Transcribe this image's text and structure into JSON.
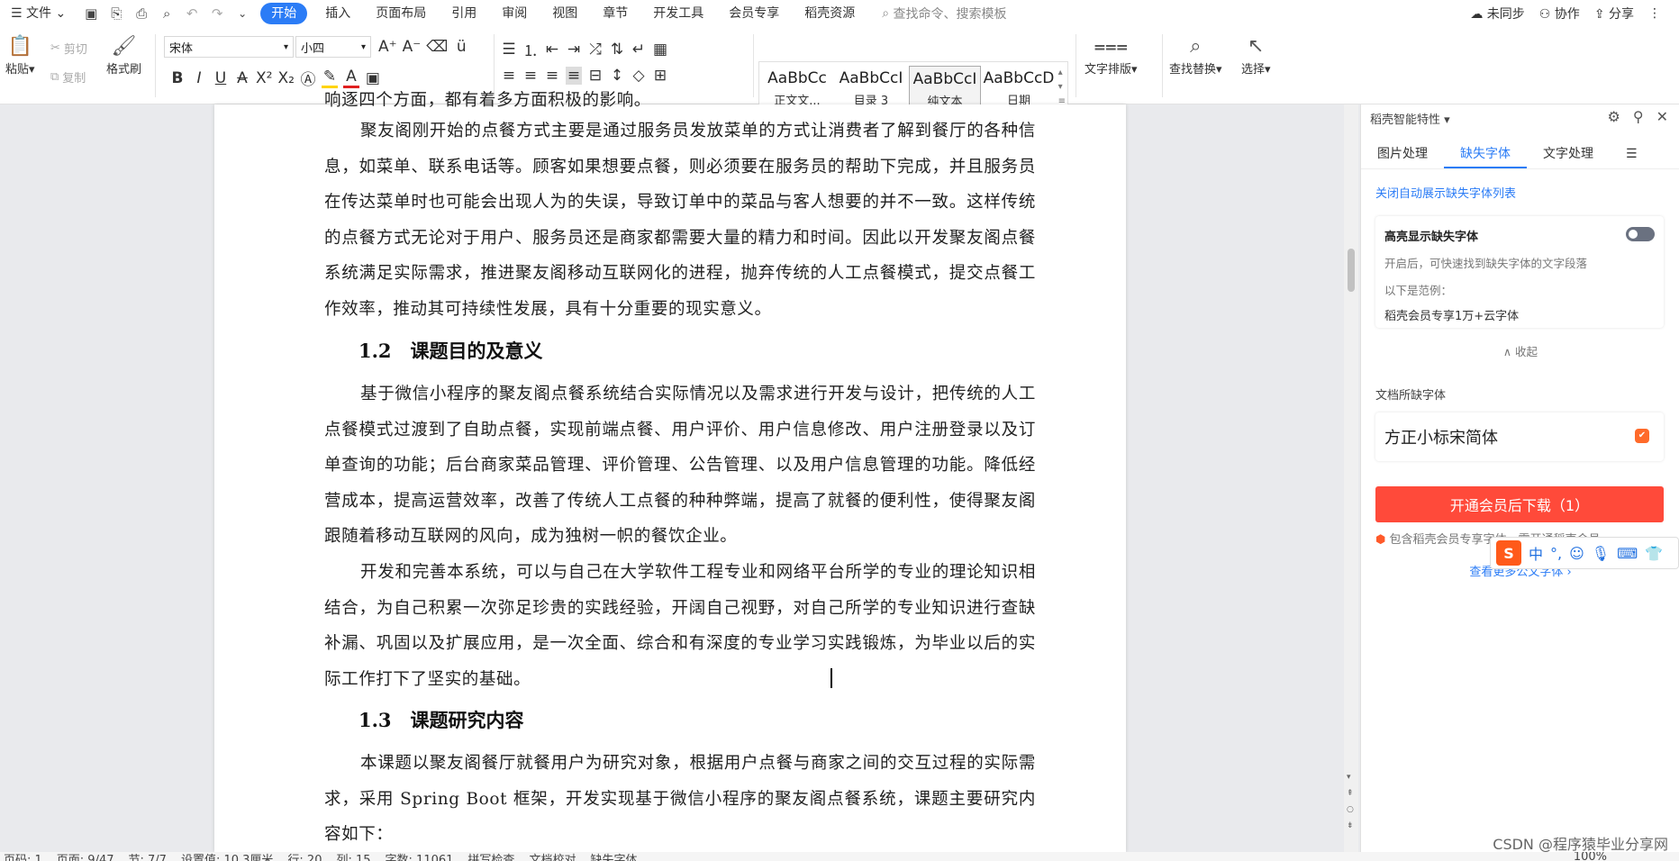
{
  "menu": {
    "file": "文件",
    "tabs": [
      "开始",
      "插入",
      "页面布局",
      "引用",
      "审阅",
      "视图",
      "章节",
      "开发工具",
      "会员专享",
      "稻壳资源"
    ],
    "search_placeholder": "查找命令、搜索模板",
    "sync": "未同步",
    "collab": "协作",
    "share": "分享"
  },
  "ribbon": {
    "paste": "粘贴",
    "cut": "剪切",
    "copy": "复制",
    "format_painter": "格式刷",
    "font_name": "宋体",
    "font_size": "小四",
    "styles": [
      {
        "preview": "AaBbCc",
        "name": "正文文..."
      },
      {
        "preview": "AaBbCcI",
        "name": "目录 3"
      },
      {
        "preview": "AaBbCcI",
        "name": "纯文本"
      },
      {
        "preview": "AaBbCcD",
        "name": "日期"
      }
    ],
    "text_layout": "文字排版",
    "find_replace": "查找替换",
    "select": "选择"
  },
  "doc": {
    "cut_top_line": "响逐四个方面，都有着多方面积极的影响。",
    "p1": "聚友阁刚开始的点餐方式主要是通过服务员发放菜单的方式让消费者了解到餐厅的各种信息，如菜单、联系电话等。顾客如果想要点餐，则必须要在服务员的帮助下完成，并且服务员在传达菜单时也可能会出现人为的失误，导致订单中的菜品与客人想要的并不一致。这样传统的点餐方式无论对于用户、服务员还是商家都需要大量的精力和时间。因此以开发聚友阁点餐系统满足实际需求，推进聚友阁移动互联网化的进程，抛弃传统的人工点餐模式，提交点餐工作效率，推动其可持续性发展，具有十分重要的现实意义。",
    "h2": "1.2　课题目的及意义",
    "p2": "基于微信小程序的聚友阁点餐系统结合实际情况以及需求进行开发与设计，把传统的人工点餐模式过渡到了自助点餐，实现前端点餐、用户评价、用户信息修改、用户注册登录以及订单查询的功能；后台商家菜品管理、评价管理、公告管理、以及用户信息管理的功能。降低经营成本，提高运营效率，改善了传统人工点餐的种种弊端，提高了就餐的便利性，使得聚友阁跟随着移动互联网的风向，成为独树一帜的餐饮企业。",
    "p3": "开发和完善本系统，可以与自己在大学软件工程专业和网络平台所学的专业的理论知识相结合，为自己积累一次弥足珍贵的实践经验，开阔自己视野，对自己所学的专业知识进行查缺补漏、巩固以及扩展应用，是一次全面、综合和有深度的专业学习实践锻炼，为毕业以后的实际工作打下了坚实的基础。",
    "h3": "1.3　课题研究内容",
    "p4": "本课题以聚友阁餐厅就餐用户为研究对象，根据用户点餐与商家之间的交互过程的实际需求，采用 Spring Boot 框架，开发实现基于微信小程序的聚友阁点餐系统，课题主要研究内容如下："
  },
  "panel": {
    "title": "稻壳智能特性",
    "tabs": [
      "图片处理",
      "缺失字体",
      "文字处理"
    ],
    "close_auto": "关闭自动展示缺失字体列表",
    "highlight_title": "高亮显示缺失字体",
    "highlight_desc": "开启后，可快速找到缺失字体的文字段落",
    "example_label": "以下是范例：",
    "example_text": "稻壳会员专享1万+云字体",
    "collapse": "收起",
    "missing_label": "文档所缺字体",
    "missing_font": "方正小标宋简体",
    "download": "开通会员后下载（1）",
    "member_note": "包含稻壳会员专享字体，需开通稻壳会员",
    "more_fonts": "查看更多公文字体"
  },
  "ime": {
    "lang": "中"
  },
  "status": {
    "items": [
      "页码: 1",
      "页面: 9/47",
      "节: 7/7",
      "设置值: 10.3厘米",
      "行: 20",
      "列: 15",
      "字数: 11061",
      "拼写检查",
      "文档校对",
      "缺失字体"
    ],
    "zoom": "100%"
  },
  "watermark": "CSDN @程序猿毕业分享网",
  "colors": {
    "accent": "#2b7cf6",
    "download": "#ff4a3a"
  }
}
